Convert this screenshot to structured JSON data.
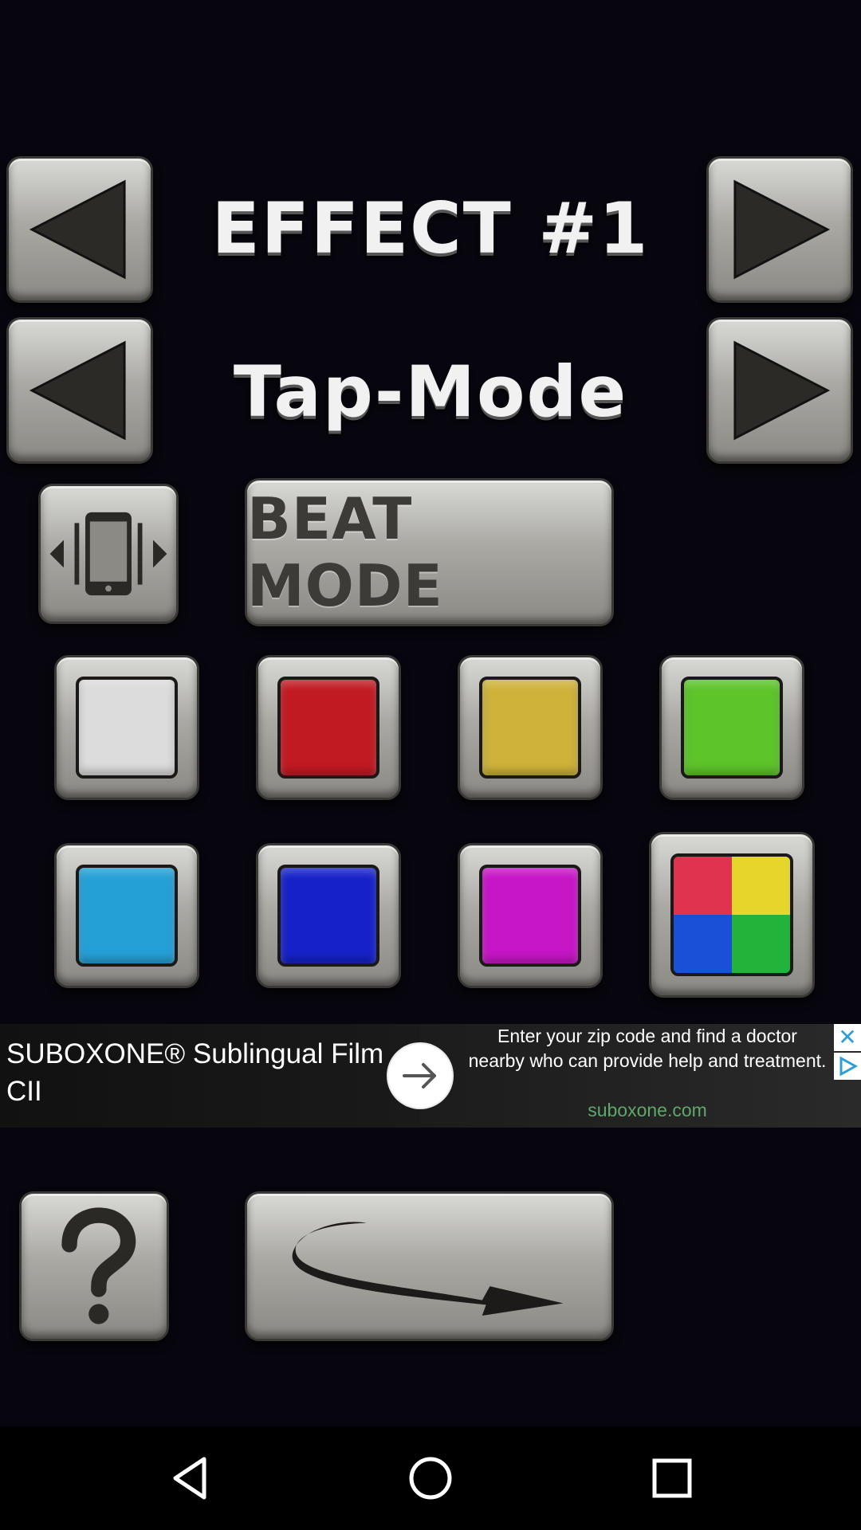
{
  "header": {
    "effect_title": "EFFECT #1",
    "mode_title": "Tap-Mode"
  },
  "beat_mode": {
    "label": "BEAT MODE"
  },
  "colors": {
    "white": "#dcdcdc",
    "red": "#c21a22",
    "yellow": "#ceb23a",
    "green": "#5dc42a",
    "cyan": "#25a0d6",
    "blue": "#1622c8",
    "magenta": "#c616c6",
    "multi": [
      "#e0334f",
      "#e6d52a",
      "#1a4fd8",
      "#23b33a"
    ]
  },
  "ad": {
    "title": "SUBOXONE® Sublingual Film CII",
    "description": "Enter your zip code and find a doctor nearby who can provide help and treatment.",
    "domain": "suboxone.com"
  },
  "icons": {
    "prev": "left-triangle-icon",
    "next": "right-triangle-icon",
    "shake": "phone-shake-icon",
    "help": "question-mark-icon",
    "share": "curved-arrow-icon"
  }
}
